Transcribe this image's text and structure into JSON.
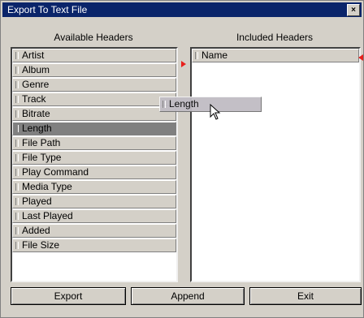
{
  "window": {
    "title": "Export To Text File",
    "close_glyph": "×"
  },
  "available": {
    "title": "Available Headers",
    "items": [
      {
        "label": "Artist"
      },
      {
        "label": "Album"
      },
      {
        "label": "Genre"
      },
      {
        "label": "Track"
      },
      {
        "label": "Bitrate"
      },
      {
        "label": "Length",
        "selected": true
      },
      {
        "label": "File Path"
      },
      {
        "label": "File Type"
      },
      {
        "label": "Play Command"
      },
      {
        "label": "Media Type"
      },
      {
        "label": "Played"
      },
      {
        "label": "Last Played"
      },
      {
        "label": "Added"
      },
      {
        "label": "File Size"
      }
    ]
  },
  "included": {
    "title": "Included Headers",
    "items": [
      {
        "label": "Name"
      }
    ]
  },
  "drag": {
    "label": "Length"
  },
  "buttons": {
    "export": "Export",
    "append": "Append",
    "exit": "Exit"
  },
  "colors": {
    "arrow": "#e8201c",
    "titlebar": "#0a246a",
    "selected_row": "#808080"
  }
}
